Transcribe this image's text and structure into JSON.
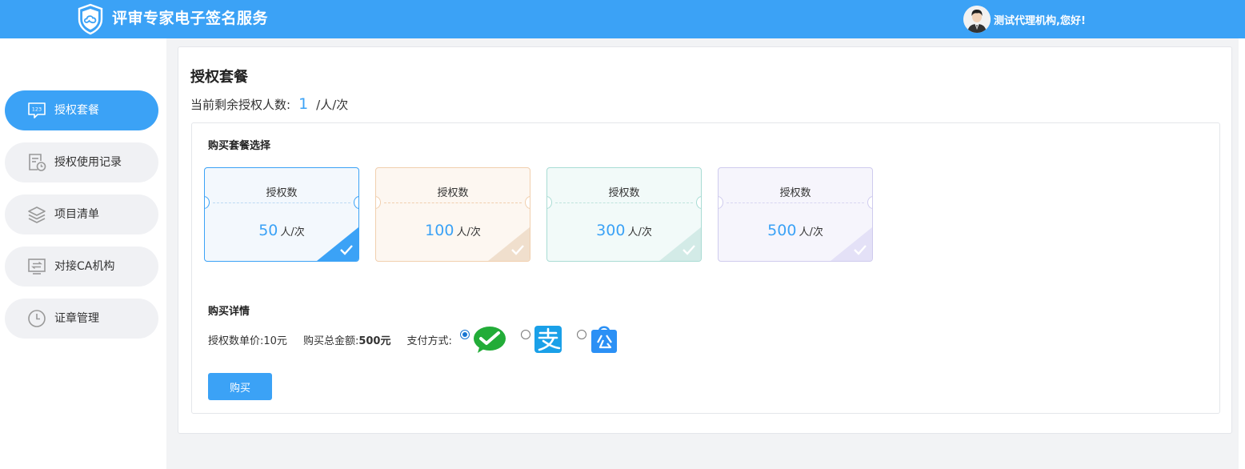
{
  "header": {
    "title": "评审专家电子签名服务",
    "greeting": "测试代理机构,您好!",
    "logo_icon": "shield-cloud-icon",
    "avatar_icon": "user-avatar-icon"
  },
  "colors": {
    "primary": "#3ba2f6",
    "header": "#3ba2f6"
  },
  "sidebar": {
    "items": [
      {
        "label": "授权套餐",
        "icon": "number-chat-icon",
        "active": true
      },
      {
        "label": "授权使用记录",
        "icon": "document-clock-icon",
        "active": false
      },
      {
        "label": "项目清单",
        "icon": "layers-icon",
        "active": false
      },
      {
        "label": "对接CA机构",
        "icon": "swap-monitor-icon",
        "active": false
      },
      {
        "label": "证章管理",
        "icon": "clock-icon",
        "active": false
      }
    ]
  },
  "main": {
    "title": "授权套餐",
    "remaining_label": "当前剩余授权人数:",
    "remaining_value": "1",
    "remaining_unit": "/人/次",
    "package_section_title": "购买套餐选择",
    "packages": [
      {
        "label": "授权数",
        "value": "50",
        "unit": "人/次",
        "selected": true
      },
      {
        "label": "授权数",
        "value": "100",
        "unit": "人/次",
        "selected": false
      },
      {
        "label": "授权数",
        "value": "300",
        "unit": "人/次",
        "selected": false
      },
      {
        "label": "授权数",
        "value": "500",
        "unit": "人/次",
        "selected": false
      }
    ],
    "detail_section_title": "购买详情",
    "unit_price_label": "授权数单价:",
    "unit_price_value": "10元",
    "total_label": "购买总金额:",
    "total_value": "500元",
    "pay_method_label": "支付方式:",
    "pay_methods": [
      {
        "icon": "wechat-pay-icon",
        "selected": true
      },
      {
        "icon": "alipay-icon",
        "selected": false
      },
      {
        "icon": "public-account-icon",
        "selected": false
      }
    ],
    "buy_button": "购买"
  }
}
